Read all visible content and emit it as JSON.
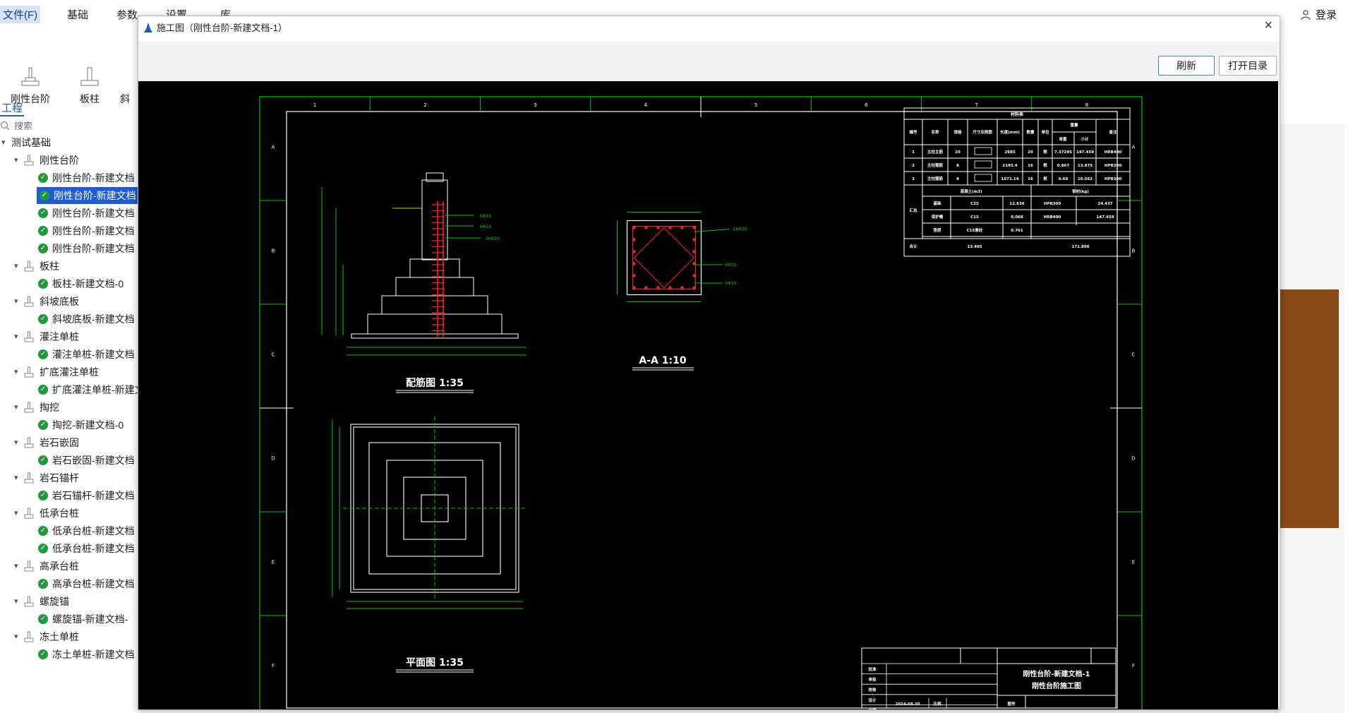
{
  "menubar": {
    "file": "文件(F)",
    "items": [
      "基础",
      "参数",
      "设置",
      "库"
    ],
    "login": "登录"
  },
  "ribbon": {
    "buttons": [
      "刚性台阶",
      "板柱",
      "斜"
    ]
  },
  "panel": {
    "tab": "工程",
    "search_placeholder": "搜索",
    "root": "测试基础",
    "groups": [
      {
        "name": "刚性台阶",
        "children": [
          "刚性台阶-新建文档",
          "刚性台阶-新建文档",
          "刚性台阶-新建文档",
          "刚性台阶-新建文档",
          "刚性台阶-新建文档"
        ]
      },
      {
        "name": "板柱",
        "children": [
          "板柱-新建文档-0"
        ]
      },
      {
        "name": "斜坡底板",
        "children": [
          "斜坡底板-新建文档"
        ]
      },
      {
        "name": "灌注单桩",
        "children": [
          "灌注单桩-新建文档"
        ]
      },
      {
        "name": "扩底灌注单桩",
        "children": [
          "扩底灌注单桩-新建文"
        ]
      },
      {
        "name": "掏挖",
        "children": [
          "掏挖-新建文档-0"
        ]
      },
      {
        "name": "岩石嵌固",
        "children": [
          "岩石嵌固-新建文档"
        ]
      },
      {
        "name": "岩石锚杆",
        "children": [
          "岩石锚杆-新建文档"
        ]
      },
      {
        "name": "低承台桩",
        "children": [
          "低承台桩-新建文档",
          "低承台桩-新建文档"
        ]
      },
      {
        "name": "高承台桩",
        "children": [
          "高承台桩-新建文档"
        ]
      },
      {
        "name": "螺旋锚",
        "children": [
          "螺旋锚-新建文档-"
        ]
      },
      {
        "name": "冻土单桩",
        "children": [
          "冻土单桩-新建文档"
        ]
      }
    ]
  },
  "dialog": {
    "title": "施工图（刚性台阶-新建文档-1）",
    "refresh": "刷新",
    "open_dir": "打开目录"
  },
  "drawing": {
    "col_labels": [
      "1",
      "2",
      "3",
      "4",
      "5",
      "6",
      "7",
      "8"
    ],
    "row_labels": [
      "A",
      "B",
      "C",
      "D",
      "E",
      "F"
    ],
    "view1_title": "配筋图 1:35",
    "view2_title": "A-A 1:10",
    "view3_title": "平面图 1:35",
    "table_title": "材料表",
    "table_headers": [
      "编号",
      "名称",
      "规格",
      "尺寸及简图",
      "长度(mm)",
      "数量",
      "单位",
      "重量",
      "备注"
    ],
    "weight_sub": [
      "单重",
      "小计"
    ],
    "rows": [
      [
        "1",
        "主柱主筋",
        "20",
        "",
        "2985",
        "20",
        "根",
        "7.37295",
        "147.459",
        "HRB400"
      ],
      [
        "2",
        "主柱箍筋",
        "8",
        "",
        "2195.4",
        "16",
        "根",
        "0.867",
        "13.875",
        "HPB300"
      ],
      [
        "3",
        "主柱箍筋",
        "8",
        "",
        "1071.14",
        "16",
        "根",
        "0.66",
        "10.562",
        "HPB300"
      ]
    ],
    "summary_label": "汇总",
    "concrete_head": "混凝土(m3)",
    "steel_head": "钢材(kg)",
    "summary_rows": [
      [
        "基础",
        "C25",
        "12.636",
        "HPB300",
        "24.437"
      ],
      [
        "保护帽",
        "C15",
        "0.068",
        "HRB400",
        "147.459"
      ],
      [
        "垫层",
        "C15素砼",
        "0.761",
        "",
        ""
      ]
    ],
    "total_label": "合计",
    "total_concrete": "13.465",
    "total_steel": "171.896",
    "title_block": {
      "doc": "刚性台阶-新建文档-1",
      "sheet": "刚性台阶施工图",
      "left_labels": [
        "批准",
        "审核",
        "校核",
        "设计",
        "日期"
      ],
      "date": "2024-08-30",
      "scale_label": "比例",
      "no_label": "图号"
    }
  },
  "colors": {
    "cad_bg": "#000000",
    "cad_line": "#00c800",
    "cad_white": "#ffffff",
    "rebar": "#ff2020",
    "selection": "#1e5bd8"
  }
}
